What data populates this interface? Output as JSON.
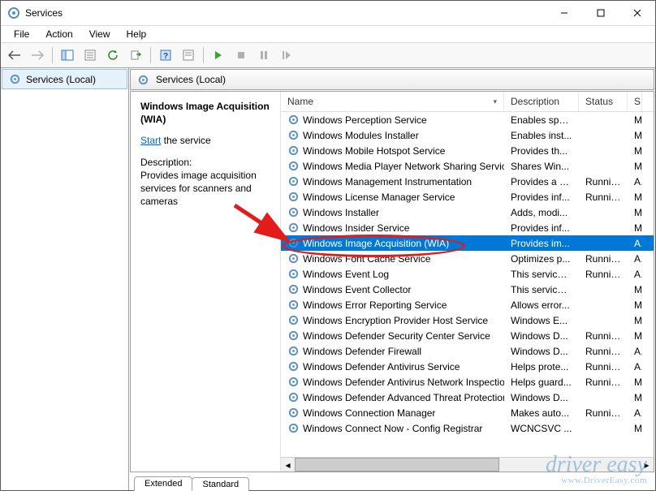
{
  "title": "Services",
  "menu": [
    "File",
    "Action",
    "View",
    "Help"
  ],
  "left_pane_item": "Services (Local)",
  "inner_header": "Services (Local)",
  "info": {
    "service_name": "Windows Image Acquisition (WIA)",
    "start_link": "Start",
    "start_suffix": " the service",
    "desc_label": "Description:",
    "description": "Provides image acquisition services for scanners and cameras"
  },
  "columns": {
    "name": "Name",
    "desc": "Description",
    "status": "Status",
    "s": "S"
  },
  "tabs": {
    "extended": "Extended",
    "standard": "Standard"
  },
  "watermark": {
    "brand": "driver easy",
    "url": "www.DriverEasy.com"
  },
  "selected_name": "Windows Image Acquisition (WIA)",
  "services": [
    {
      "name": "Windows Perception Service",
      "desc": "Enables spa...",
      "status": "",
      "s": "M"
    },
    {
      "name": "Windows Modules Installer",
      "desc": "Enables inst...",
      "status": "",
      "s": "M"
    },
    {
      "name": "Windows Mobile Hotspot Service",
      "desc": "Provides th...",
      "status": "",
      "s": "M"
    },
    {
      "name": "Windows Media Player Network Sharing Service",
      "desc": "Shares Win...",
      "status": "",
      "s": "M"
    },
    {
      "name": "Windows Management Instrumentation",
      "desc": "Provides a c...",
      "status": "Running",
      "s": "A"
    },
    {
      "name": "Windows License Manager Service",
      "desc": "Provides inf...",
      "status": "Running",
      "s": "M"
    },
    {
      "name": "Windows Installer",
      "desc": "Adds, modi...",
      "status": "",
      "s": "M"
    },
    {
      "name": "Windows Insider Service",
      "desc": "Provides inf...",
      "status": "",
      "s": "M"
    },
    {
      "name": "Windows Image Acquisition (WIA)",
      "desc": "Provides im...",
      "status": "",
      "s": "A"
    },
    {
      "name": "Windows Font Cache Service",
      "desc": "Optimizes p...",
      "status": "Running",
      "s": "A"
    },
    {
      "name": "Windows Event Log",
      "desc": "This service ...",
      "status": "Running",
      "s": "A"
    },
    {
      "name": "Windows Event Collector",
      "desc": "This service ...",
      "status": "",
      "s": "M"
    },
    {
      "name": "Windows Error Reporting Service",
      "desc": "Allows error...",
      "status": "",
      "s": "M"
    },
    {
      "name": "Windows Encryption Provider Host Service",
      "desc": "Windows E...",
      "status": "",
      "s": "M"
    },
    {
      "name": "Windows Defender Security Center Service",
      "desc": "Windows D...",
      "status": "Running",
      "s": "M"
    },
    {
      "name": "Windows Defender Firewall",
      "desc": "Windows D...",
      "status": "Running",
      "s": "A"
    },
    {
      "name": "Windows Defender Antivirus Service",
      "desc": "Helps prote...",
      "status": "Running",
      "s": "A"
    },
    {
      "name": "Windows Defender Antivirus Network Inspectio...",
      "desc": "Helps guard...",
      "status": "Running",
      "s": "M"
    },
    {
      "name": "Windows Defender Advanced Threat Protection ...",
      "desc": "Windows D...",
      "status": "",
      "s": "M"
    },
    {
      "name": "Windows Connection Manager",
      "desc": "Makes auto...",
      "status": "Running",
      "s": "A"
    },
    {
      "name": "Windows Connect Now - Config Registrar",
      "desc": "WCNCSVC ...",
      "status": "",
      "s": "M"
    }
  ]
}
